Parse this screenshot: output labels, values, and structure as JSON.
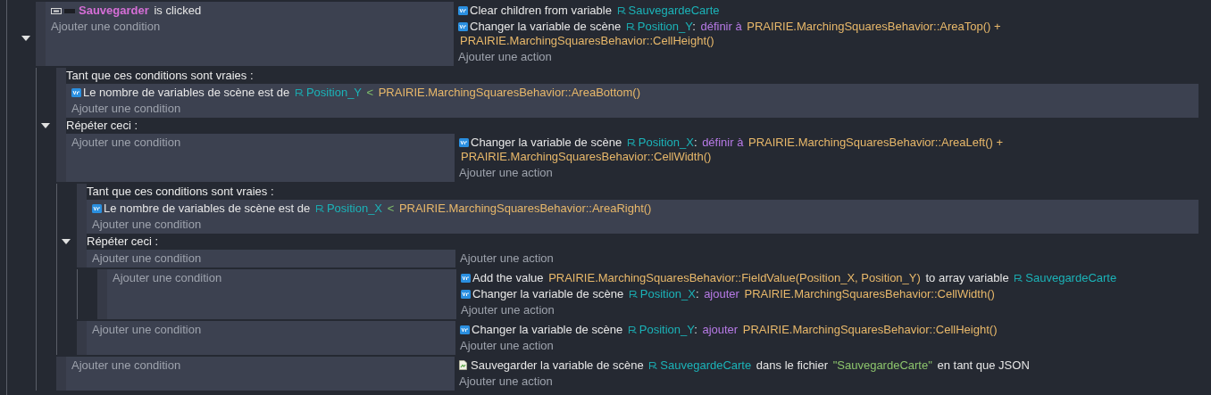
{
  "events": [
    {
      "kind": "standard",
      "expanded": true,
      "conditions": [
        {
          "kind": "button",
          "parts": [
            {
              "kind": "object",
              "text": "Sauvegarder"
            },
            {
              "kind": "text",
              "text": "is clicked"
            }
          ]
        }
      ],
      "add_condition": "Ajouter une condition",
      "actions": [
        {
          "kind": "variable",
          "parts": [
            {
              "kind": "text",
              "text": "Clear children from variable"
            },
            {
              "kind": "var",
              "text": "SauvegardeCarte"
            }
          ]
        },
        {
          "kind": "variable",
          "parts": [
            {
              "kind": "text",
              "text": "Changer la variable de scène"
            },
            {
              "kind": "var",
              "text": "Position_Y"
            },
            {
              "kind": "punct",
              "text": ":"
            },
            {
              "kind": "keyword",
              "text": "définir à"
            },
            {
              "kind": "expr",
              "text": "PRAIRIE.MarchingSquaresBehavior::AreaTop() +"
            },
            {
              "kind": "expr",
              "text": "PRAIRIE.MarchingSquaresBehavior::CellHeight()"
            }
          ]
        }
      ],
      "add_action": "Ajouter une action",
      "children": [
        {
          "kind": "while",
          "expanded": true,
          "while_label": "Tant que ces conditions sont vraies :",
          "while_conditions": [
            {
              "kind": "variable",
              "parts": [
                {
                  "kind": "text",
                  "text": "Le nombre de variables de scène est de"
                },
                {
                  "kind": "var",
                  "text": "Position_Y"
                },
                {
                  "kind": "operator",
                  "text": "<"
                },
                {
                  "kind": "expr",
                  "text": "PRAIRIE.MarchingSquaresBehavior::AreaBottom()"
                }
              ]
            }
          ],
          "while_add_condition": "Ajouter une condition",
          "repeat_label": "Répéter ceci :",
          "add_condition": "Ajouter une condition",
          "actions": [
            {
              "kind": "variable",
              "parts": [
                {
                  "kind": "text",
                  "text": "Changer la variable de scène"
                },
                {
                  "kind": "var",
                  "text": "Position_X"
                },
                {
                  "kind": "punct",
                  "text": ":"
                },
                {
                  "kind": "keyword",
                  "text": "définir à"
                },
                {
                  "kind": "expr",
                  "text": "PRAIRIE.MarchingSquaresBehavior::AreaLeft() +"
                },
                {
                  "kind": "expr",
                  "text": "PRAIRIE.MarchingSquaresBehavior::CellWidth()"
                }
              ]
            }
          ],
          "add_action": "Ajouter une action",
          "children": [
            {
              "kind": "while",
              "expanded": true,
              "while_label": "Tant que ces conditions sont vraies :",
              "while_conditions": [
                {
                  "kind": "variable",
                  "parts": [
                    {
                      "kind": "text",
                      "text": "Le nombre de variables de scène est de"
                    },
                    {
                      "kind": "var",
                      "text": "Position_X"
                    },
                    {
                      "kind": "operator",
                      "text": "<"
                    },
                    {
                      "kind": "expr",
                      "text": "PRAIRIE.MarchingSquaresBehavior::AreaRight()"
                    }
                  ]
                }
              ],
              "while_add_condition": "Ajouter une condition",
              "repeat_label": "Répéter ceci :",
              "add_condition": "Ajouter une condition",
              "add_action": "Ajouter une action",
              "children": [
                {
                  "kind": "standard",
                  "add_condition": "Ajouter une condition",
                  "actions": [
                    {
                      "kind": "variable",
                      "parts": [
                        {
                          "kind": "text",
                          "text": "Add the value"
                        },
                        {
                          "kind": "expr",
                          "text": "PRAIRIE.MarchingSquaresBehavior::FieldValue(Position_X, Position_Y)"
                        },
                        {
                          "kind": "text",
                          "text": "to array variable"
                        },
                        {
                          "kind": "var",
                          "text": "SauvegardeCarte"
                        }
                      ]
                    },
                    {
                      "kind": "variable",
                      "parts": [
                        {
                          "kind": "text",
                          "text": "Changer la variable de scène"
                        },
                        {
                          "kind": "var",
                          "text": "Position_X"
                        },
                        {
                          "kind": "punct",
                          "text": ":"
                        },
                        {
                          "kind": "keyword",
                          "text": "ajouter"
                        },
                        {
                          "kind": "expr",
                          "text": "PRAIRIE.MarchingSquaresBehavior::CellWidth()"
                        }
                      ]
                    }
                  ],
                  "add_action": "Ajouter une action"
                }
              ]
            },
            {
              "kind": "standard",
              "add_condition": "Ajouter une condition",
              "actions": [
                {
                  "kind": "variable",
                  "parts": [
                    {
                      "kind": "text",
                      "text": "Changer la variable de scène"
                    },
                    {
                      "kind": "var",
                      "text": "Position_Y"
                    },
                    {
                      "kind": "punct",
                      "text": ":"
                    },
                    {
                      "kind": "keyword",
                      "text": "ajouter"
                    },
                    {
                      "kind": "expr",
                      "text": "PRAIRIE.MarchingSquaresBehavior::CellHeight()"
                    }
                  ]
                }
              ],
              "add_action": "Ajouter une action"
            }
          ]
        },
        {
          "kind": "standard",
          "add_condition": "Ajouter une condition",
          "actions": [
            {
              "kind": "storage",
              "parts": [
                {
                  "kind": "text",
                  "text": "Sauvegarder la variable de scène"
                },
                {
                  "kind": "var",
                  "text": "SauvegardeCarte"
                },
                {
                  "kind": "text",
                  "text": "dans le fichier"
                },
                {
                  "kind": "string",
                  "text": "\"SauvegardeCarte\""
                },
                {
                  "kind": "text",
                  "text": "en tant que JSON"
                }
              ]
            }
          ],
          "add_action": "Ajouter une action"
        }
      ]
    }
  ]
}
